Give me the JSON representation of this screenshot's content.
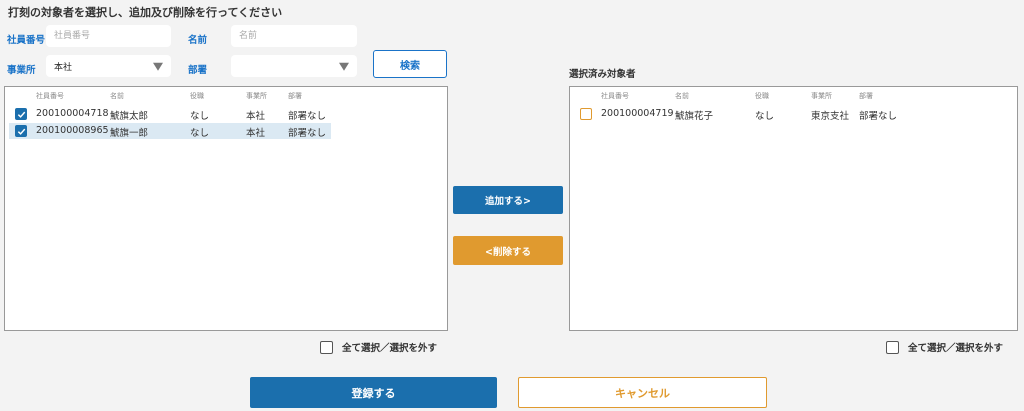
{
  "title": "打刻の対象者を選択し、追加及び削除を行ってください",
  "search": {
    "emp_no_label": "社員番号",
    "emp_no_placeholder": "社員番号",
    "name_label": "名前",
    "name_placeholder": "名前",
    "office_label": "事業所",
    "office_value": "本社",
    "dept_label": "部署",
    "dept_value": "",
    "search_button": "検索"
  },
  "left_list": {
    "headers": [
      "社員番号",
      "名前",
      "役職",
      "事業所",
      "部署"
    ],
    "rows": [
      {
        "emp_no": "200100004718",
        "name": "鯱旗太郎",
        "position": "なし",
        "office": "本社",
        "dept": "部署なし",
        "checked": true,
        "selected": false
      },
      {
        "emp_no": "200100008965",
        "name": "鯱旗一郎",
        "position": "なし",
        "office": "本社",
        "dept": "部署なし",
        "checked": true,
        "selected": true
      }
    ],
    "select_all": "全て選択／選択を外す"
  },
  "actions": {
    "add": "追加する>",
    "remove": "<削除する"
  },
  "right_list": {
    "title": "選択済み対象者",
    "headers": [
      "社員番号",
      "名前",
      "役職",
      "事業所",
      "部署"
    ],
    "rows": [
      {
        "emp_no": "200100004719",
        "name": "鯱旗花子",
        "position": "なし",
        "office": "東京支社",
        "dept": "部署なし",
        "checked": false
      }
    ],
    "select_all": "全て選択／選択を外す"
  },
  "footer": {
    "register": "登録する",
    "cancel": "キャンセル"
  },
  "colors": {
    "primary": "#1b6fad",
    "accent": "#e09a2f",
    "label_blue": "#1a73c8",
    "selected_row": "#dbe9f3"
  }
}
